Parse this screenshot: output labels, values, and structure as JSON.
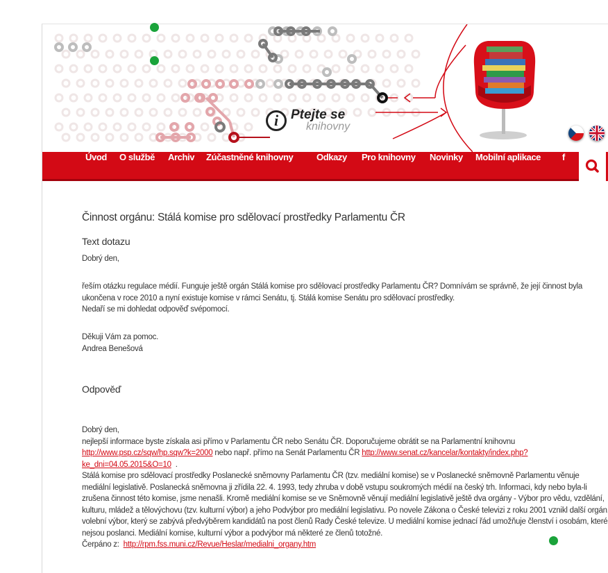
{
  "site": {
    "logo_line1": "Ptejte se",
    "logo_line2": "knihovny",
    "logo_letter": "i",
    "brand_color": "#d30a15",
    "languages": [
      "cz-flag-icon",
      "uk-flag-icon"
    ]
  },
  "nav": {
    "items": [
      "Úvod",
      "O službě",
      "Archiv",
      "Zúčastněné knihovny",
      "Odkazy",
      "Pro knihovny",
      "Novinky",
      "Mobilní aplikace",
      "f"
    ],
    "search_icon": "search-icon"
  },
  "article": {
    "title": "Činnost orgánu: Stálá komise pro sdělovací prostředky Parlamentu ČR",
    "question_heading": "Text dotazu",
    "question_greeting": "Dobrý den,",
    "question_body": "řeším otázku regulace médií. Funguje ještě orgán Stálá komise pro sdělovací prostředky Parlamentu ČR? Domnívám se správně, že její činnost byla ukončena v roce 2010 a nyní existuje komise v rámci Senátu, tj. Stálá komise Senátu pro sdělovací prostředky.",
    "question_body2": "Nedaří se mi dohledat odpověď svépomocí.",
    "question_thanks": "Děkuji Vám za pomoc.",
    "question_author": "Andrea Benešová",
    "answer_heading": "Odpověď",
    "answer_greeting": "Dobrý den,",
    "answer_intro": "nejlepší informace byste získala asi přímo v Parlamentu ČR nebo Senátu ČR. Doporučujeme obrátit se na Parlamentní knihovnu",
    "link_psp": "http://www.psp.cz/sqw/hp.sqw?k=2000",
    "answer_mid": "nebo např. přímo na Senát Parlamentu ČR",
    "link_senat": "http://www.senat.cz/kancelar/kontakty/index.php?ke_dni=04.05.2015&O=10",
    "answer_after": ".",
    "answer_body": "Stálá komise pro sdělovací prostředky Poslanecké sněmovny Parlamentu ČR (tzv. mediální komise) se v Poslanecké sněmovně Parlamentu věnuje mediální legislativě.  Poslanecká sněmovna ji zřídila 22. 4. 1993, tedy zhruba v době vstupu soukromých médií na český trh. Informaci, kdy nebo byla-li  zrušena činnost této komise, jsme nenašli. Kromě mediální komise se ve Sněmovně věnují mediální legislativě ještě dva orgány - Výbor pro vědu, vzdělání, kulturu, mládež a tělovýchovu (tzv. kulturní výbor) a jeho Podvýbor pro mediální legislativu. Po novele Zákona o České televizi z roku 2001 vznikl další orgán, volební výbor, který se zabývá předvýběrem kandidátů na post členů Rady České televize. U mediální komise jednací řád umožňuje členství i osobám, které nejsou poslanci.  Mediální komise, kulturní výbor a podvýbor má některé ze členů totožné.",
    "source_label": "Čerpáno z:",
    "link_source": "http://rpm.fss.muni.cz/Revue/Heslar/medialni_organy.htm"
  }
}
